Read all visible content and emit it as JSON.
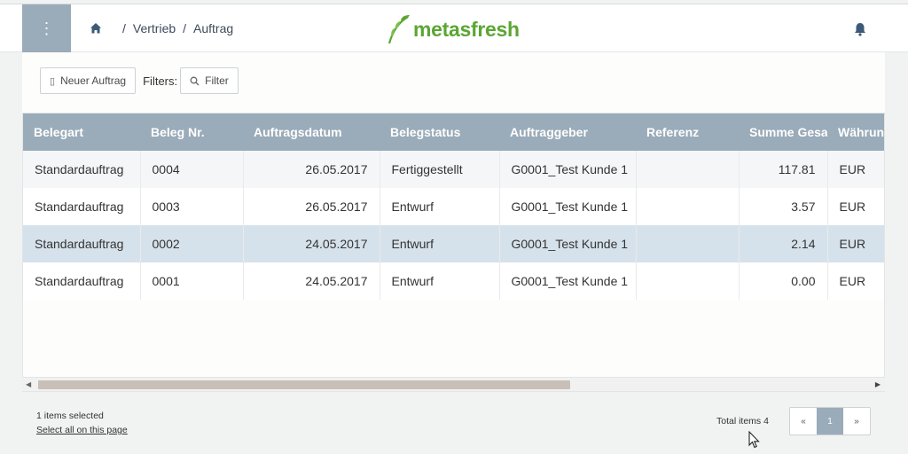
{
  "header": {
    "menu_icon": "⋮",
    "breadcrumb": [
      {
        "sep": "/",
        "label": "Vertrieb"
      },
      {
        "sep": "/",
        "label": "Auftrag"
      }
    ],
    "logo_text": "metasfresh",
    "logo_color": "#5ba633",
    "accent_color": "#9aabb9"
  },
  "toolbar": {
    "new_button_label": "Neuer Auftrag",
    "filters_label": "Filters:",
    "filter_button_label": "Filter"
  },
  "table": {
    "columns": [
      "Belegart",
      "Beleg Nr.",
      "Auftragsdatum",
      "Belegstatus",
      "Auftraggeber",
      "Referenz",
      "Summe Gesamt",
      "Währung"
    ],
    "rows": [
      {
        "belegart": "Standardauftrag",
        "beleg_nr": "0004",
        "datum": "26.05.2017",
        "status": "Fertiggestellt",
        "auftraggeber": "G0001_Test Kunde 1",
        "referenz": "",
        "summe": "117.81",
        "waehrung": "EUR",
        "selected": false
      },
      {
        "belegart": "Standardauftrag",
        "beleg_nr": "0003",
        "datum": "26.05.2017",
        "status": "Entwurf",
        "auftraggeber": "G0001_Test Kunde 1",
        "referenz": "",
        "summe": "3.57",
        "waehrung": "EUR",
        "selected": false
      },
      {
        "belegart": "Standardauftrag",
        "beleg_nr": "0002",
        "datum": "24.05.2017",
        "status": "Entwurf",
        "auftraggeber": "G0001_Test Kunde 1",
        "referenz": "",
        "summe": "2.14",
        "waehrung": "EUR",
        "selected": true
      },
      {
        "belegart": "Standardauftrag",
        "beleg_nr": "0001",
        "datum": "24.05.2017",
        "status": "Entwurf",
        "auftraggeber": "G0001_Test Kunde 1",
        "referenz": "",
        "summe": "0.00",
        "waehrung": "EUR",
        "selected": false
      }
    ]
  },
  "footer": {
    "selected_text": "1 items selected",
    "select_all_label": "Select all on this page",
    "total_text": "Total items 4",
    "pager_prev": "«",
    "pager_current": "1",
    "pager_next": "»"
  }
}
